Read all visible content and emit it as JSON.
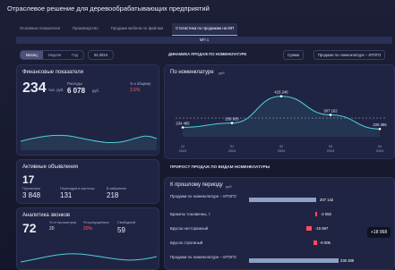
{
  "app": {
    "title": "Отраслевое решение для деревообрабатывающих предприятий"
  },
  "tabs": [
    {
      "label": "Основные показатели"
    },
    {
      "label": "Производство"
    },
    {
      "label": "Продажи мебели по файлам"
    },
    {
      "label": "Статистика по продажам на МП",
      "active": true
    }
  ],
  "marketplace_label": "МП 1",
  "controls": {
    "periods": [
      "Месяц",
      "Неделя",
      "Год"
    ],
    "active_period": "Месяц",
    "date": "04.2024"
  },
  "cards": {
    "financial": {
      "title": "Финансовые показатели",
      "main_value": "234",
      "main_unit": "тыс. руб.",
      "sub1_label": "Расходы",
      "sub1_value": "6 078",
      "sub1_unit": "руб.",
      "sub2_label": "% к общему",
      "sub2_value": "2,6%"
    },
    "listings": {
      "title": "Активные объявления",
      "main_value": "17",
      "s1_label": "Просмотры",
      "s1_value": "3 848",
      "s2_label": "Переходов в карточку",
      "s2_value": "131",
      "s3_label": "В избранное",
      "s3_value": "218"
    },
    "calls": {
      "title": "Аналитика звонков",
      "main_value": "72",
      "c1_label": "% от просмотров",
      "c1_value": "20",
      "c2_label": "% пропущенных",
      "c2_value": "20%",
      "c3_label": "Свободный",
      "c3_value": "59"
    }
  },
  "nomenclature_chart": {
    "title": "По номенклатуре",
    "unit": "руб",
    "header": "ДИНАМИКА ПРОДАЖ ПО НОМЕНКЛАТУРЕ",
    "selector1": "Сумма",
    "selector2": "Продажи по номенклатуре – ИТОГО"
  },
  "chart_data": {
    "type": "line",
    "x": [
      "12\n2023",
      "01\n2024",
      "02\n2024",
      "03\n2024",
      "04\n2024"
    ],
    "series": [
      {
        "values": [
          234485,
          259935,
          415246,
          307162,
          225395
        ]
      }
    ],
    "point_labels": [
      "234 485",
      "259 935",
      "415 246",
      "307 162",
      "225 395"
    ]
  },
  "growth": {
    "title": "ПРИРОСТ ПРОДАЖ ПО ВИДАМ НОМЕНКЛАТУРЫ",
    "period_label": "К прошлому периоду",
    "unit": "руб",
    "rows": [
      {
        "label": "Продажи по номенклатуре – ИТОГО",
        "value": "207 142"
      },
      {
        "label": "Бракеты тоновенны, т",
        "value": "-2 063"
      },
      {
        "label": "Брусок несторанный",
        "value": "-15 597"
      },
      {
        "label": "Брусок строганый",
        "value": "-6 005"
      },
      {
        "label": "Продажи по номенклатуре – ИТОГО",
        "value": "235 389"
      }
    ],
    "badge": "+18 068"
  }
}
